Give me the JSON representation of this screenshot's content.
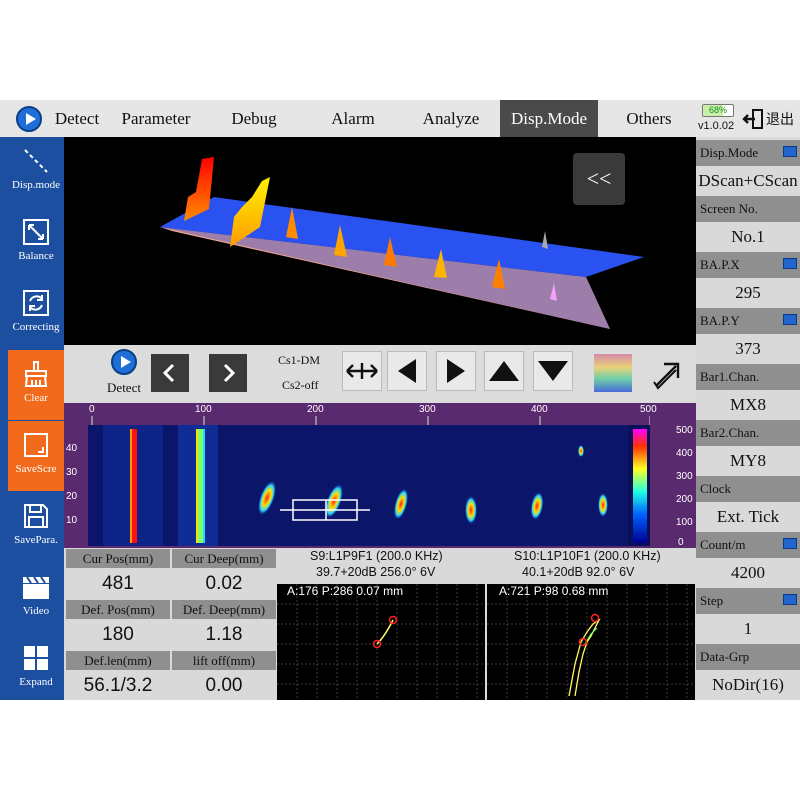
{
  "menu": {
    "tabs": [
      {
        "label": "Detect"
      },
      {
        "label": "Parameter"
      },
      {
        "label": "Debug"
      },
      {
        "label": "Alarm"
      },
      {
        "label": "Analyze"
      },
      {
        "label": "Disp.Mode"
      },
      {
        "label": "Others"
      }
    ],
    "active_tab": "Disp.Mode",
    "battery": "68%",
    "battery_level": 0.68,
    "version": "v1.0.02",
    "exit_label": "退出"
  },
  "toolbar": {
    "items": [
      {
        "label": "Disp.mode",
        "icon": "diagonal-dashes-icon"
      },
      {
        "label": "Balance",
        "icon": "balance-icon"
      },
      {
        "label": "Correcting",
        "icon": "refresh-icon"
      },
      {
        "label": "Clear",
        "icon": "brush-icon"
      },
      {
        "label": "SaveScre",
        "icon": "screenshot-icon"
      },
      {
        "label": "SavePara.",
        "icon": "floppy-icon"
      },
      {
        "label": "Video",
        "icon": "clapperboard-icon"
      },
      {
        "label": "Expand",
        "icon": "grid-icon"
      }
    ]
  },
  "view3d": {
    "collapse_label": "<<"
  },
  "controls": {
    "detect_label": "Detect",
    "cs1": "Cs1-DM",
    "cs2": "Cs2-off"
  },
  "cscan": {
    "x_ticks": [
      "0",
      "100",
      "200",
      "300",
      "400",
      "500"
    ],
    "y_ticks": [
      "40",
      "30",
      "20",
      "10"
    ],
    "color_ticks": [
      "500",
      "400",
      "300",
      "200",
      "100",
      "0"
    ]
  },
  "values": {
    "cur_pos_label": "Cur Pos(mm)",
    "cur_pos": "481",
    "cur_deep_label": "Cur Deep(mm)",
    "cur_deep": "0.02",
    "def_pos_label": "Def. Pos(mm)",
    "def_pos": "180",
    "def_deep_label": "Def. Deep(mm)",
    "def_deep": "1.18",
    "def_len_label": "Def.len(mm)",
    "def_len": "56.1/3.2",
    "lift_off_label": "lift off(mm)",
    "lift_off": "0.00"
  },
  "ascan1": {
    "channel": "S9:L1P9F1 (200.0 KHz)",
    "params": "39.7+20dB 256.0° 6V",
    "header": "A:176 P:286  0.07  mm"
  },
  "ascan2": {
    "channel": "S10:L1P10F1 (200.0 KHz)",
    "params": "40.1+20dB 92.0° 6V",
    "header": "A:721 P:98  0.68  mm"
  },
  "params": {
    "disp_mode_label": "Disp.Mode",
    "disp_mode": "DScan+CScan",
    "screen_no_label": "Screen No.",
    "screen_no": "No.1",
    "bapx_label": "BA.P.X",
    "bapx": "295",
    "bapy_label": "BA.P.Y",
    "bapy": "373",
    "bar1_label": "Bar1.Chan.",
    "bar1": "MX8",
    "bar2_label": "Bar2.Chan.",
    "bar2": "MY8",
    "clock_label": "Clock",
    "clock": "Ext. Tick",
    "count_label": "Count/m",
    "count": "4200",
    "step_label": "Step",
    "step": "1",
    "data_grp_label": "Data-Grp",
    "data_grp": "NoDir(16)"
  },
  "colors": {
    "toolbar_bg": "#1d4fa0",
    "orange": "#f26a1b",
    "cscan_frame": "#5a2a6e",
    "label_bg": "#8f8f8f",
    "active_tab": "#4a4a4a"
  }
}
